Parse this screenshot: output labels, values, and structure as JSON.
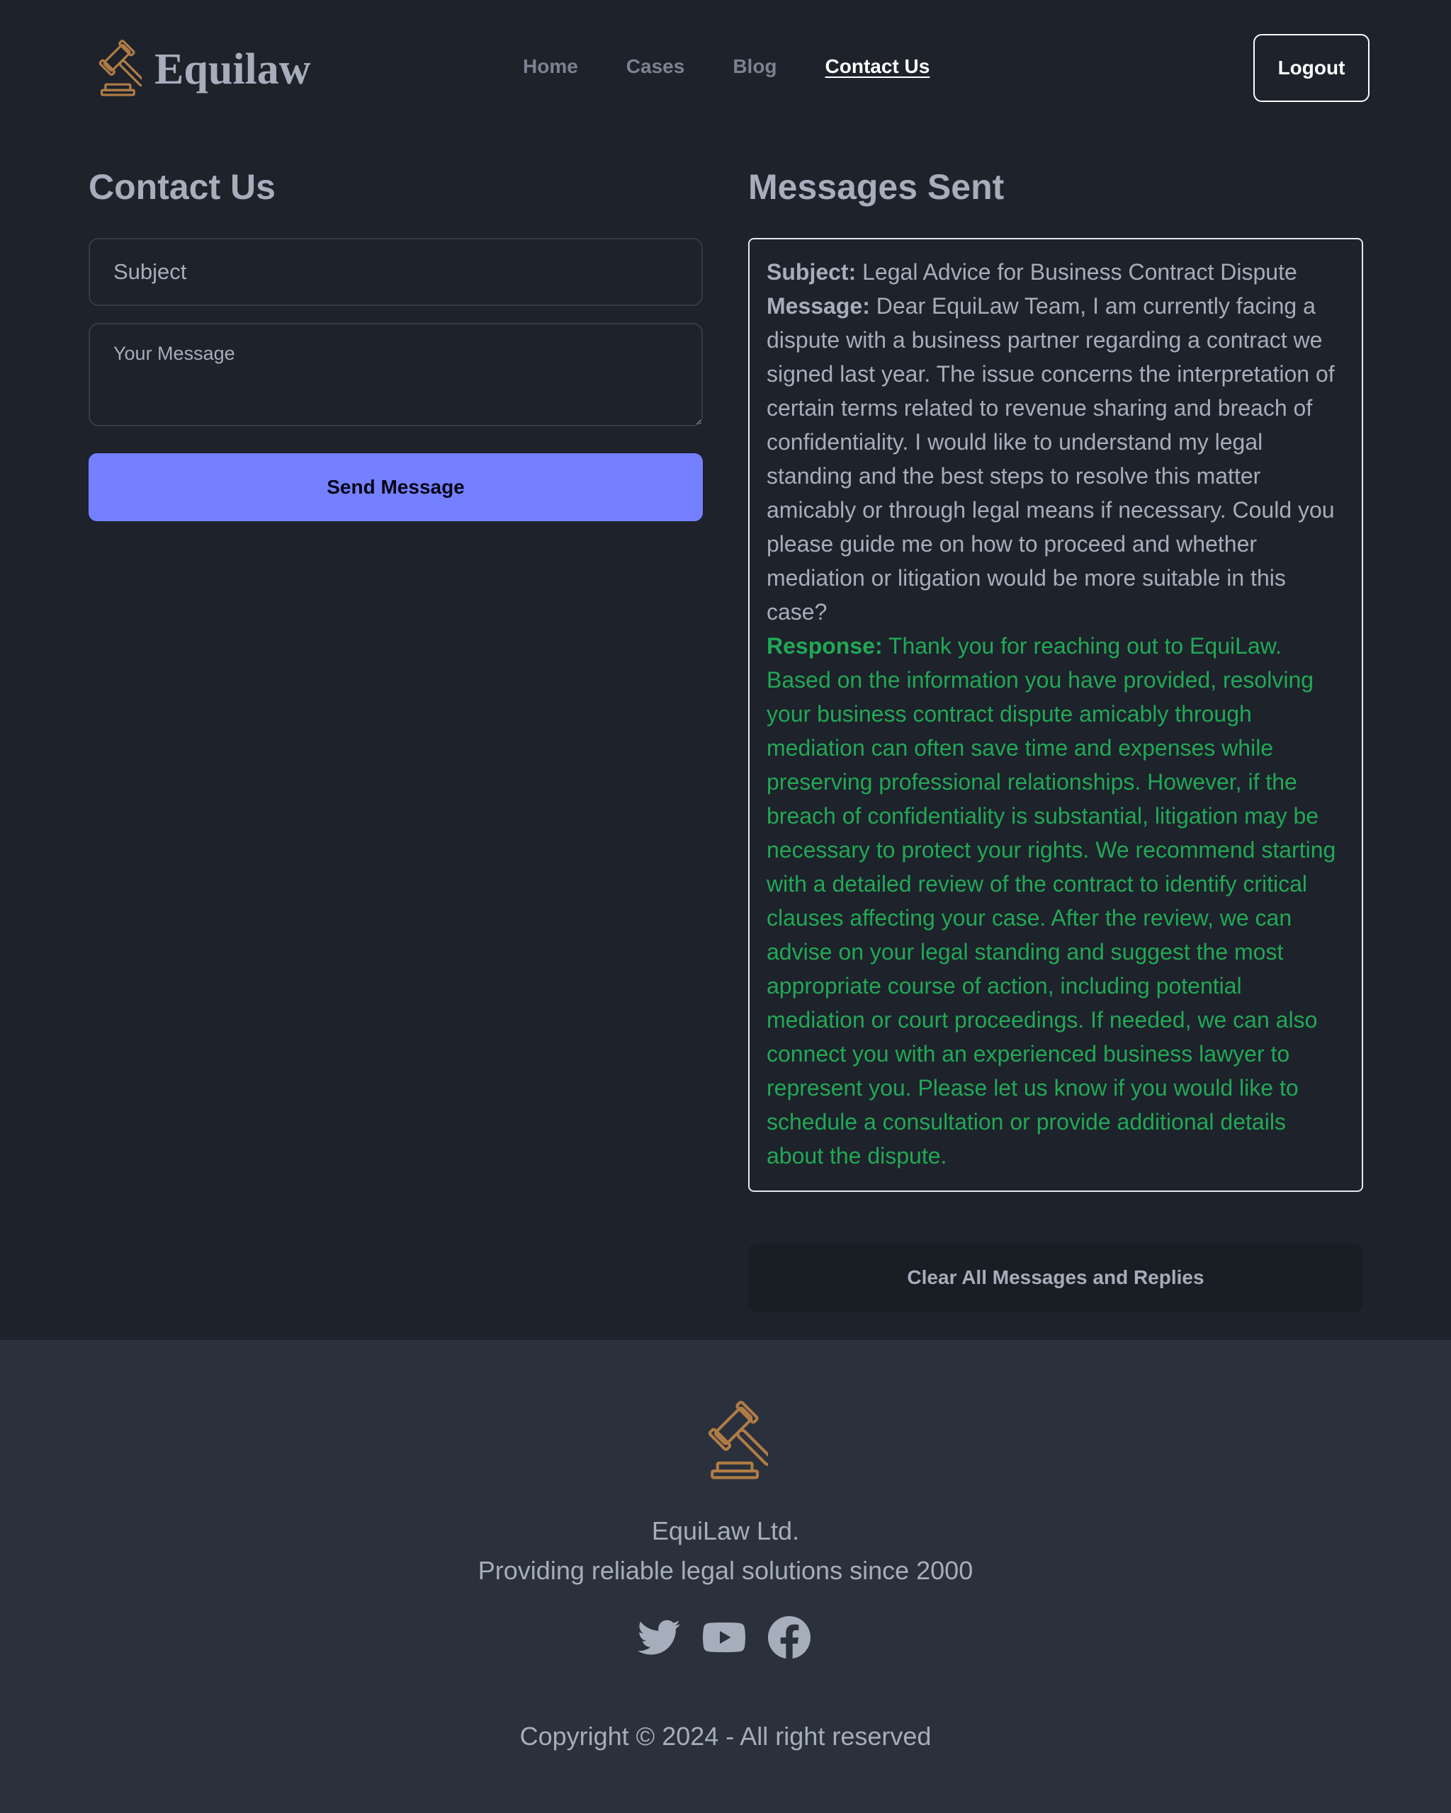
{
  "header": {
    "logo_text": "Equilaw",
    "logo_icon": "gavel-icon",
    "nav": [
      {
        "label": "Home"
      },
      {
        "label": "Cases"
      },
      {
        "label": "Blog"
      },
      {
        "label": "Contact Us",
        "active": true
      }
    ],
    "logout_label": "Logout"
  },
  "contact_form": {
    "title": "Contact Us",
    "subject_placeholder": "Subject",
    "subject_value": "",
    "message_placeholder": "Your Message",
    "message_value": "",
    "send_label": "Send Message"
  },
  "messages": {
    "title": "Messages Sent",
    "items": [
      {
        "subject_label": "Subject:",
        "subject": "Legal Advice for Business Contract Dispute",
        "message_label": "Message:",
        "message": "Dear EquiLaw Team, I am currently facing a dispute with a business partner regarding a contract we signed last year. The issue concerns the interpretation of certain terms related to revenue sharing and breach of confidentiality. I would like to understand my legal standing and the best steps to resolve this matter amicably or through legal means if necessary. Could you please guide me on how to proceed and whether mediation or litigation would be more suitable in this case?",
        "response_label": "Response:",
        "response": "Thank you for reaching out to EquiLaw. Based on the information you have provided, resolving your business contract dispute amicably through mediation can often save time and expenses while preserving professional relationships. However, if the breach of confidentiality is substantial, litigation may be necessary to protect your rights. We recommend starting with a detailed review of the contract to identify critical clauses affecting your case. After the review, we can advise on your legal standing and suggest the most appropriate course of action, including potential mediation or court proceedings. If needed, we can also connect you with an experienced business lawyer to represent you. Please let us know if you would like to schedule a consultation or provide additional details about the dispute."
      }
    ],
    "clear_label": "Clear All Messages and Replies"
  },
  "footer": {
    "company": "EquiLaw Ltd.",
    "tagline": "Providing reliable legal solutions since 2000",
    "social_icons": [
      "twitter-icon",
      "youtube-icon",
      "facebook-icon"
    ],
    "copyright": "Copyright © 2024 - All right reserved"
  },
  "colors": {
    "background": "#1d222b",
    "footer_background": "#2a303c",
    "primary_button": "#7480ff",
    "response_text": "#22a855",
    "logo_accent": "#b07c45",
    "text": "#a6adbb"
  }
}
